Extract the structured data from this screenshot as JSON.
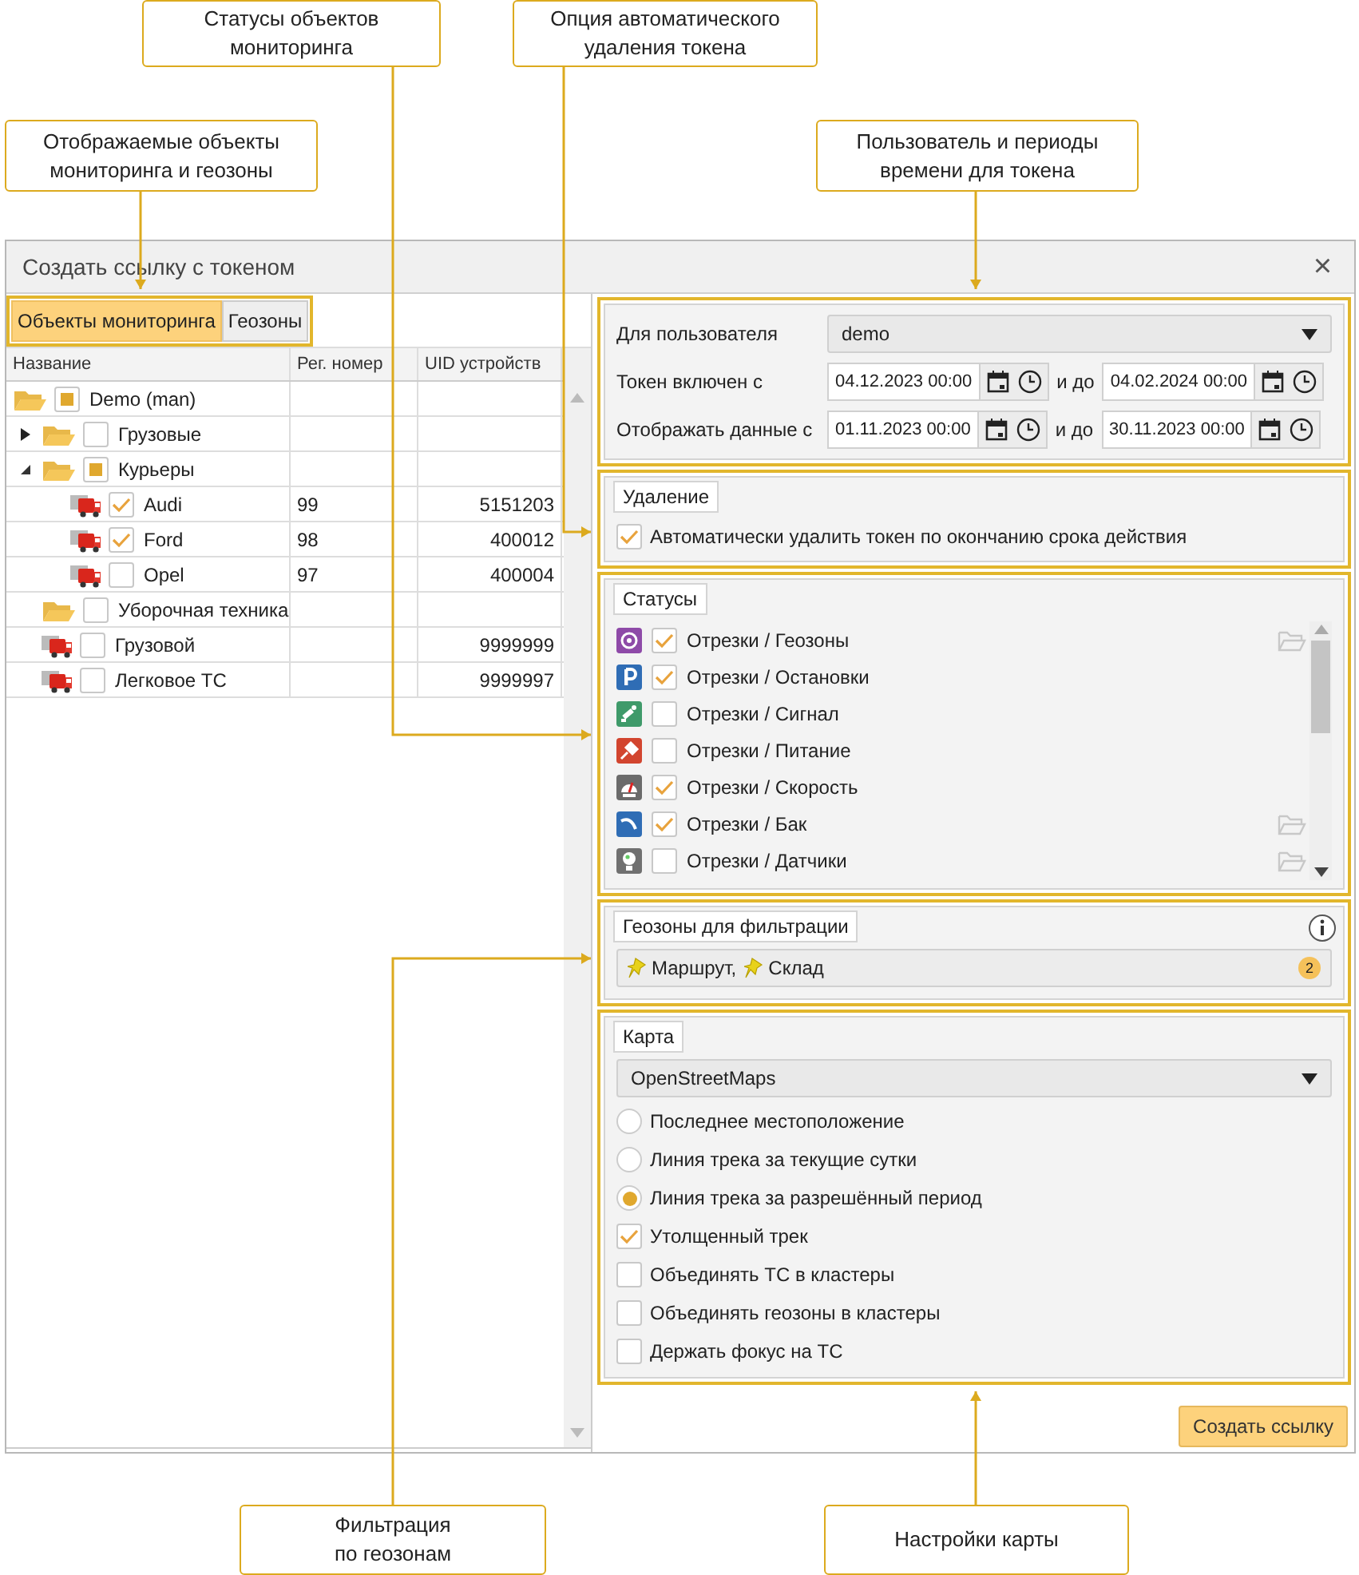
{
  "callouts": [
    {
      "text": "Отображаемые объекты\nмониторинга и геозоны"
    },
    {
      "text": "Статусы объектов\nмониторинга"
    },
    {
      "text": "Опция автоматического\nудаления токена"
    },
    {
      "text": "Пользователь и периоды\nвремени для токена"
    },
    {
      "text": "Фильтрация\nпо геозонам"
    },
    {
      "text": "Настройки карты"
    }
  ],
  "window": {
    "title": "Создать ссылку с токеном",
    "close": "×"
  },
  "tabs": [
    {
      "label": "Объекты мониторинга",
      "selected": true
    },
    {
      "label": "Геозоны",
      "selected": false
    }
  ],
  "table": {
    "columns": [
      "Название",
      "Рег. номер",
      "UID устройств"
    ],
    "rows": [
      {
        "kind": "folder",
        "name": "Demo (man)",
        "checked": false,
        "partial": true,
        "children": [
          {
            "kind": "folder",
            "name": "Грузовые",
            "checked": false,
            "partial": false,
            "expanded": false
          },
          {
            "kind": "folder",
            "name": "Курьеры",
            "checked": false,
            "partial": true,
            "expanded": true,
            "children": [
              {
                "kind": "vehicle",
                "name": "Audi",
                "checked": true,
                "partial": false,
                "reg": "99",
                "uid": "5151203"
              },
              {
                "kind": "vehicle",
                "name": "Ford",
                "checked": true,
                "partial": false,
                "reg": "98",
                "uid": "400012"
              },
              {
                "kind": "vehicle",
                "name": "Opel",
                "checked": false,
                "partial": false,
                "reg": "97",
                "uid": "400004"
              }
            ]
          },
          {
            "kind": "folder",
            "name": "Уборочная техника",
            "checked": false,
            "partial": false
          },
          {
            "kind": "vehicle",
            "name": "Грузовой",
            "checked": false,
            "partial": false,
            "uid": "9999999"
          },
          {
            "kind": "vehicle",
            "name": "Легковое ТС",
            "checked": false,
            "partial": false,
            "uid": "9999997"
          }
        ]
      }
    ]
  },
  "access": {
    "user_label": "Для пользователя",
    "user": "demo",
    "periods": [
      {
        "label": "Токен включен с",
        "from": "04.12.2023 00:00",
        "to_label": "и до",
        "to": "04.02.2024 00:00"
      },
      {
        "label": "Отображать данные с",
        "from": "01.11.2023 00:00",
        "to_label": "и до",
        "to": "30.11.2023 00:00"
      }
    ]
  },
  "deletion": {
    "legend": "Удаление",
    "label": "Автоматически удалить токен по окончанию срока действия",
    "checked": true
  },
  "statuses": {
    "legend": "Статусы",
    "items": [
      {
        "kind": "zone",
        "label": "Отрезки / Геозоны",
        "checked": true,
        "folder_icon": true
      },
      {
        "kind": "parking",
        "label": "Отрезки / Остановки",
        "checked": true,
        "folder_icon": false
      },
      {
        "kind": "signal",
        "label": "Отрезки / Сигнал",
        "checked": false,
        "folder_icon": false
      },
      {
        "kind": "power",
        "label": "Отрезки / Питание",
        "checked": false,
        "folder_icon": false
      },
      {
        "kind": "speed",
        "label": "Отрезки / Скорость",
        "checked": true,
        "folder_icon": false
      },
      {
        "kind": "fuel",
        "label": "Отрезки / Бак",
        "checked": true,
        "folder_icon": true
      },
      {
        "kind": "sensor",
        "label": "Отрезки / Датчики",
        "checked": false,
        "folder_icon": true
      }
    ]
  },
  "geozones": {
    "legend": "Геозоны для фильтрации",
    "items": [
      "Маршрут,",
      "Склад"
    ],
    "count": "2"
  },
  "map": {
    "legend": "Карта",
    "provider": "OpenStreetMaps",
    "options": [
      {
        "kind": "radio",
        "label": "Последнее местоположение",
        "selected": false
      },
      {
        "kind": "radio",
        "label": "Линия трека за текущие сутки",
        "selected": false
      },
      {
        "kind": "radio",
        "label": "Линия трека за разрешённый период",
        "selected": true
      },
      {
        "kind": "checkbox",
        "label": "Утолщенный трек",
        "checked": true
      },
      {
        "kind": "checkbox",
        "label": "Объединять ТС в кластеры",
        "checked": false
      },
      {
        "kind": "checkbox",
        "label": "Объединять геозоны в кластеры",
        "checked": false
      },
      {
        "kind": "checkbox",
        "label": "Держать фокус на ТС",
        "checked": false
      }
    ]
  },
  "button": "Создать ссылку"
}
